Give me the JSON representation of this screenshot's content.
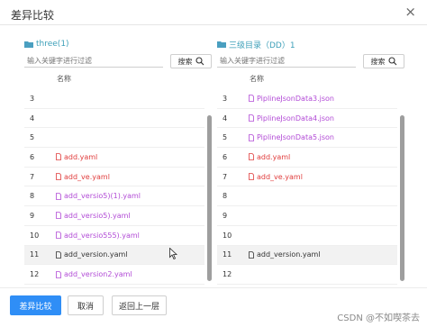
{
  "dialog": {
    "title": "差异比较",
    "close_glyph": "×"
  },
  "left_panel": {
    "title": "three(1)",
    "search_placeholder": "输入关键字进行过滤",
    "search_button": "搜索",
    "column_header": "名称",
    "rows": [
      {
        "num": "3",
        "name": "",
        "color": ""
      },
      {
        "num": "4",
        "name": "",
        "color": ""
      },
      {
        "num": "5",
        "name": "",
        "color": ""
      },
      {
        "num": "6",
        "name": "add.yaml",
        "color": "red"
      },
      {
        "num": "7",
        "name": "add_ve.yaml",
        "color": "red"
      },
      {
        "num": "8",
        "name": "add_versio5)(1).yaml",
        "color": "purple"
      },
      {
        "num": "9",
        "name": "add_versio5).yaml",
        "color": "purple"
      },
      {
        "num": "10",
        "name": "add_versio555).yaml",
        "color": "purple"
      },
      {
        "num": "11",
        "name": "add_version.yaml",
        "color": "gray"
      },
      {
        "num": "12",
        "name": "add_version2.yaml",
        "color": "purple"
      }
    ]
  },
  "right_panel": {
    "title": "三级目录（DD）1",
    "search_placeholder": "输入关键字进行过滤",
    "search_button": "搜索",
    "column_header": "名称",
    "rows": [
      {
        "num": "3",
        "name": "PiplineJsonData3.json",
        "color": "purple"
      },
      {
        "num": "4",
        "name": "PiplineJsonData4.json",
        "color": "purple"
      },
      {
        "num": "5",
        "name": "PiplineJsonData5.json",
        "color": "purple"
      },
      {
        "num": "6",
        "name": "add.yaml",
        "color": "red"
      },
      {
        "num": "7",
        "name": "add_ve.yaml",
        "color": "red"
      },
      {
        "num": "8",
        "name": "",
        "color": ""
      },
      {
        "num": "9",
        "name": "",
        "color": ""
      },
      {
        "num": "10",
        "name": "",
        "color": ""
      },
      {
        "num": "11",
        "name": "add_version.yaml",
        "color": "gray"
      },
      {
        "num": "12",
        "name": "",
        "color": ""
      }
    ]
  },
  "footer": {
    "compare_button": "差异比较",
    "cancel_button": "取消",
    "back_button": "返回上一层"
  },
  "watermark": "CSDN @不如喫茶去",
  "colors": {
    "primary": "#2f8ef6",
    "added_red": "#e03c3c",
    "changed_purple": "#b24bd6",
    "folder_teal": "#3c9fb8"
  },
  "icons": {
    "folder": "folder-icon",
    "file": "file-icon",
    "search": "search-icon",
    "close": "close-icon"
  }
}
